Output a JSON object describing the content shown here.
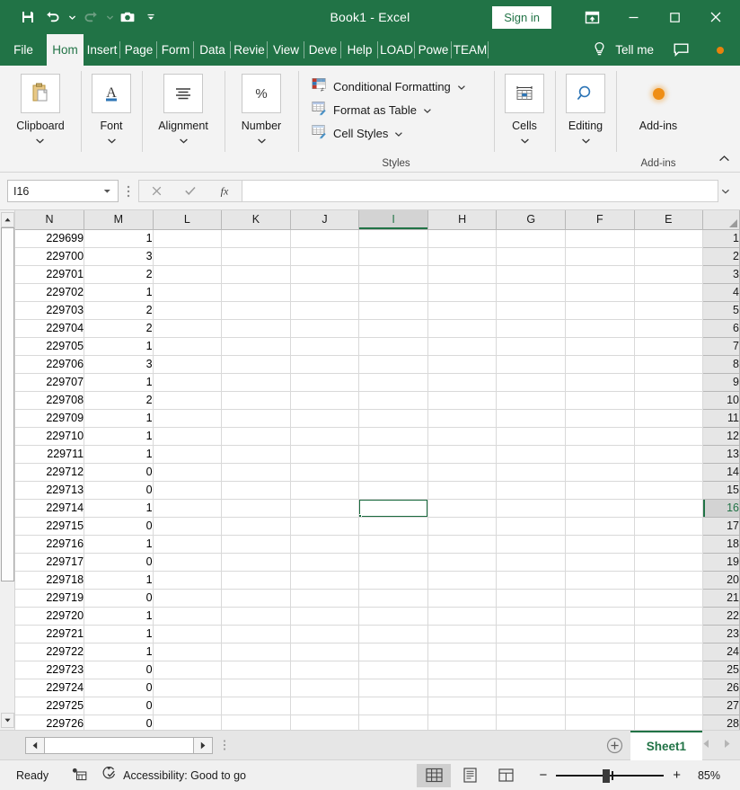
{
  "titlebar": {
    "document_title": "Book1  -  Excel",
    "signin_label": "Sign in",
    "quick_access": [
      {
        "name": "save-icon",
        "label": "Save"
      },
      {
        "name": "undo-icon",
        "label": "Undo"
      },
      {
        "name": "redo-icon",
        "label": "Redo"
      },
      {
        "name": "camera-icon",
        "label": "Screenshot"
      },
      {
        "name": "customize-quick-access-icon",
        "label": "Customize Quick Access Toolbar"
      }
    ],
    "window_controls": [
      {
        "name": "ribbon-display-options-icon",
        "label": "Ribbon Display Options"
      },
      {
        "name": "minimize-icon",
        "label": "Minimize"
      },
      {
        "name": "maximize-icon",
        "label": "Maximize"
      },
      {
        "name": "close-icon",
        "label": "Close"
      }
    ]
  },
  "tabs": [
    {
      "label": "File",
      "active": false
    },
    {
      "label": "Hom",
      "active": true
    },
    {
      "label": "Insert",
      "active": false
    },
    {
      "label": "Page",
      "active": false
    },
    {
      "label": "Form",
      "active": false
    },
    {
      "label": "Data",
      "active": false
    },
    {
      "label": "Revie",
      "active": false
    },
    {
      "label": "View",
      "active": false
    },
    {
      "label": "Deve",
      "active": false
    },
    {
      "label": "Help",
      "active": false
    },
    {
      "label": "LOAD",
      "active": false
    },
    {
      "label": "Powe",
      "active": false
    },
    {
      "label": "TEAM",
      "active": false
    }
  ],
  "tellme": {
    "label": "Tell me",
    "icon": "lightbulb-icon",
    "comments_icon": "comment-icon",
    "addin_icon": "addin-dot-icon"
  },
  "ribbon": {
    "groups": [
      {
        "label": "Clipboard",
        "icon": "clipboard-icon",
        "has_chevron": true
      },
      {
        "label": "Font",
        "icon": "font-icon",
        "has_chevron": true
      },
      {
        "label": "Alignment",
        "icon": "alignment-icon",
        "has_chevron": true
      },
      {
        "label": "Number",
        "icon": "percent-icon",
        "has_chevron": true
      }
    ],
    "styles": {
      "caption": "Styles",
      "items": [
        {
          "label": "Conditional Formatting",
          "icon": "conditional-formatting-icon"
        },
        {
          "label": "Format as Table",
          "icon": "format-as-table-icon"
        },
        {
          "label": "Cell Styles",
          "icon": "cell-styles-icon"
        }
      ]
    },
    "cells": {
      "label": "Cells",
      "icon": "cells-icon",
      "has_chevron": true
    },
    "editing": {
      "label": "Editing",
      "icon": "magnifier-icon",
      "has_chevron": true
    },
    "addins": {
      "label": "Add-ins",
      "icon": "addin-dot-icon",
      "caption": "Add-ins"
    },
    "collapse_icon": "collapse-ribbon-chevron-up-icon"
  },
  "formula_bar": {
    "namebox_value": "I16",
    "namebox_placeholder": "Name Box",
    "cancel_icon": "cancel-x-icon",
    "enter_icon": "enter-check-icon",
    "fx_icon": "insert-function-fx-icon",
    "formula_value": "",
    "formula_placeholder": "",
    "expand_icon": "expand-formula-bar-chevron-down-icon",
    "more_icon": "more-options-dots-icon"
  },
  "grid": {
    "columns": [
      "N",
      "M",
      "L",
      "K",
      "J",
      "I",
      "H",
      "G",
      "F",
      "E"
    ],
    "selected_column": "I",
    "selected_row": 16,
    "selected_cell": "I16",
    "rows": [
      {
        "row": 1,
        "N": "229699",
        "M": "1"
      },
      {
        "row": 2,
        "N": "229700",
        "M": "3"
      },
      {
        "row": 3,
        "N": "229701",
        "M": "2"
      },
      {
        "row": 4,
        "N": "229702",
        "M": "1"
      },
      {
        "row": 5,
        "N": "229703",
        "M": "2"
      },
      {
        "row": 6,
        "N": "229704",
        "M": "2"
      },
      {
        "row": 7,
        "N": "229705",
        "M": "1"
      },
      {
        "row": 8,
        "N": "229706",
        "M": "3"
      },
      {
        "row": 9,
        "N": "229707",
        "M": "1"
      },
      {
        "row": 10,
        "N": "229708",
        "M": "2"
      },
      {
        "row": 11,
        "N": "229709",
        "M": "1"
      },
      {
        "row": 12,
        "N": "229710",
        "M": "1"
      },
      {
        "row": 13,
        "N": "229711",
        "M": "1"
      },
      {
        "row": 14,
        "N": "229712",
        "M": "0"
      },
      {
        "row": 15,
        "N": "229713",
        "M": "0"
      },
      {
        "row": 16,
        "N": "229714",
        "M": "1"
      },
      {
        "row": 17,
        "N": "229715",
        "M": "0"
      },
      {
        "row": 18,
        "N": "229716",
        "M": "1"
      },
      {
        "row": 19,
        "N": "229717",
        "M": "0"
      },
      {
        "row": 20,
        "N": "229718",
        "M": "1"
      },
      {
        "row": 21,
        "N": "229719",
        "M": "0"
      },
      {
        "row": 22,
        "N": "229720",
        "M": "1"
      },
      {
        "row": 23,
        "N": "229721",
        "M": "1"
      },
      {
        "row": 24,
        "N": "229722",
        "M": "1"
      },
      {
        "row": 25,
        "N": "229723",
        "M": "0"
      },
      {
        "row": 26,
        "N": "229724",
        "M": "0"
      },
      {
        "row": 27,
        "N": "229725",
        "M": "0"
      },
      {
        "row": 28,
        "N": "229726",
        "M": "0"
      }
    ]
  },
  "sheet_tabs": {
    "tabs": [
      {
        "label": "Sheet1",
        "active": true
      }
    ],
    "add_sheet_icon": "add-sheet-plus-icon",
    "prev_icon": "prev-sheet-arrow-icon",
    "next_icon": "next-sheet-arrow-icon",
    "hscroll_left_icon": "hscroll-left-arrow-icon",
    "hscroll_right_icon": "hscroll-right-arrow-icon"
  },
  "statusbar": {
    "mode": "Ready",
    "macro_icon": "record-macro-icon",
    "accessibility_icon": "accessibility-icon",
    "accessibility_label": "Accessibility: Good to go",
    "views": [
      {
        "name": "normal-view-icon",
        "label": "Normal",
        "active": true
      },
      {
        "name": "page-layout-view-icon",
        "label": "Page Layout",
        "active": false
      },
      {
        "name": "page-break-preview-icon",
        "label": "Page Break Preview",
        "active": false
      }
    ],
    "zoom_out_label": "−",
    "zoom_in_label": "+",
    "zoom_level": "85%"
  },
  "colors": {
    "excel_green": "#217346",
    "selection_green": "#1b6b3f",
    "ribbon_bg": "#f3f3f3",
    "header_bg": "#e6e6e6",
    "accent_orange": "#e8820c"
  }
}
